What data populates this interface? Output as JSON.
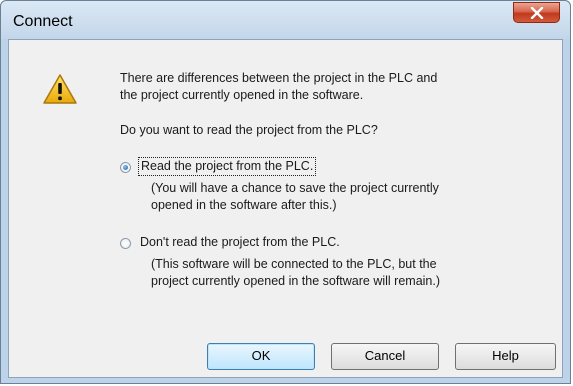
{
  "dialog": {
    "title": "Connect",
    "message_line1": "There are differences between the project in the PLC and",
    "message_line2": "the project currently opened in the software.",
    "question": "Do you want to read the project from the PLC?",
    "options": [
      {
        "label": "Read the project from the PLC.",
        "desc_line1": "(You will have a chance to save the project currently",
        "desc_line2": "opened in the software after this.)",
        "selected": true
      },
      {
        "label": "Don't read the project from the PLC.",
        "desc_line1": "(This software will be connected to the PLC, but the",
        "desc_line2": "project currently opened in the software will remain.)",
        "selected": false
      }
    ],
    "buttons": {
      "ok": "OK",
      "cancel": "Cancel",
      "help": "Help"
    }
  },
  "icons": {
    "warning": "warning-icon",
    "close": "close-icon"
  },
  "colors": {
    "client_background": "#f0f0f0",
    "frame": "#bcd3e9",
    "close_button": "#c7432a",
    "warning_fill": "#f5c518"
  }
}
